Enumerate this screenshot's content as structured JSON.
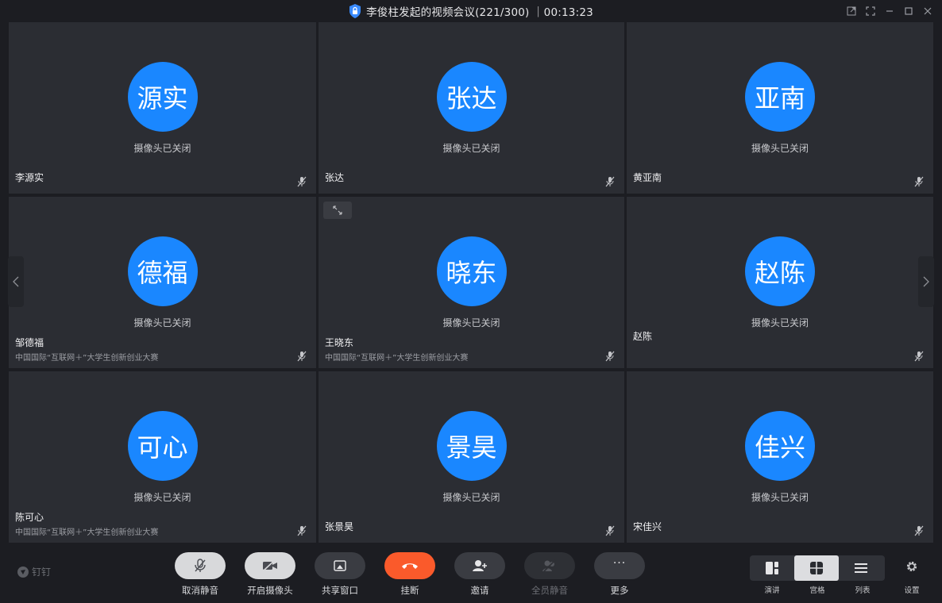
{
  "window": {
    "title": "李俊柱发起的视频会议(221/300) ｜00:13:23"
  },
  "participants": [
    {
      "avatar": "源实",
      "status": "摄像头已关闭",
      "name": "李源实",
      "org": ""
    },
    {
      "avatar": "张达",
      "status": "摄像头已关闭",
      "name": "张达",
      "org": ""
    },
    {
      "avatar": "亚南",
      "status": "摄像头已关闭",
      "name": "黄亚南",
      "org": ""
    },
    {
      "avatar": "德福",
      "status": "摄像头已关闭",
      "name": "邹德福",
      "org": "中国国际“互联网＋”大学生创新创业大赛"
    },
    {
      "avatar": "晓东",
      "status": "摄像头已关闭",
      "name": "王晓东",
      "org": "中国国际“互联网＋”大学生创新创业大赛"
    },
    {
      "avatar": "赵陈",
      "status": "摄像头已关闭",
      "name": "赵陈",
      "org": ""
    },
    {
      "avatar": "可心",
      "status": "摄像头已关闭",
      "name": "陈可心",
      "org": "中国国际“互联网＋”大学生创新创业大赛"
    },
    {
      "avatar": "景昊",
      "status": "摄像头已关闭",
      "name": "张景昊",
      "org": ""
    },
    {
      "avatar": "佳兴",
      "status": "摄像头已关闭",
      "name": "宋佳兴",
      "org": ""
    }
  ],
  "toolbar": {
    "brand": "钉钉",
    "unmute": "取消静音",
    "camera_on": "开启摄像头",
    "share_window": "共享窗口",
    "hang_up": "挂断",
    "invite": "邀请",
    "mute_all": "全员静音",
    "more": "更多",
    "more_icon": "···"
  },
  "views": {
    "speaker": "演讲",
    "grid": "宫格",
    "list": "列表",
    "settings": "设置"
  },
  "colors": {
    "avatar_blue": "#1a87ff",
    "hangup_red": "#fa5a2b",
    "tile_bg": "#2b2d33"
  }
}
